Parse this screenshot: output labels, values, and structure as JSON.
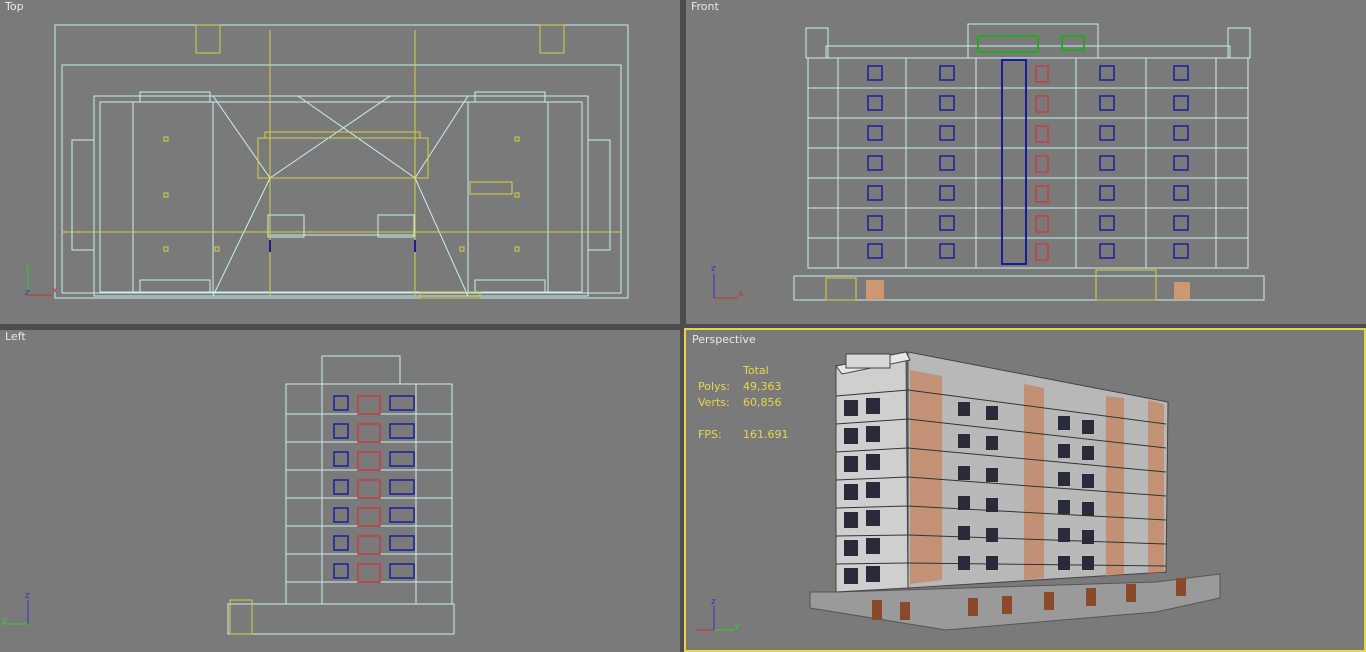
{
  "viewports": {
    "top": {
      "label": "Top"
    },
    "front": {
      "label": "Front"
    },
    "left": {
      "label": "Left"
    },
    "perspective": {
      "label": "Perspective"
    }
  },
  "stats": {
    "header": "Total",
    "polys_label": "Polys:",
    "polys_value": "49,363",
    "verts_label": "Verts:",
    "verts_value": "60,856",
    "fps_label": "FPS:",
    "fps_value": "161.691"
  },
  "axes": {
    "top": {
      "h": "x",
      "v": "y",
      "c": "z"
    },
    "front": {
      "h": "x",
      "v": "z"
    },
    "left": {
      "h": "y",
      "v": "z"
    },
    "perspective": {
      "h": "y",
      "v": "z"
    }
  },
  "colors": {
    "viewport_bg": "#7a7a7a",
    "frame": "#4d4d4d",
    "active_border": "#e8d64a",
    "stats_text": "#e8d64a",
    "wire_cyan": "#bfeaea",
    "wire_yellow": "#d8d040",
    "wire_blue": "#1c1c9a",
    "wire_red": "#c84040",
    "wire_green": "#22aa22"
  }
}
